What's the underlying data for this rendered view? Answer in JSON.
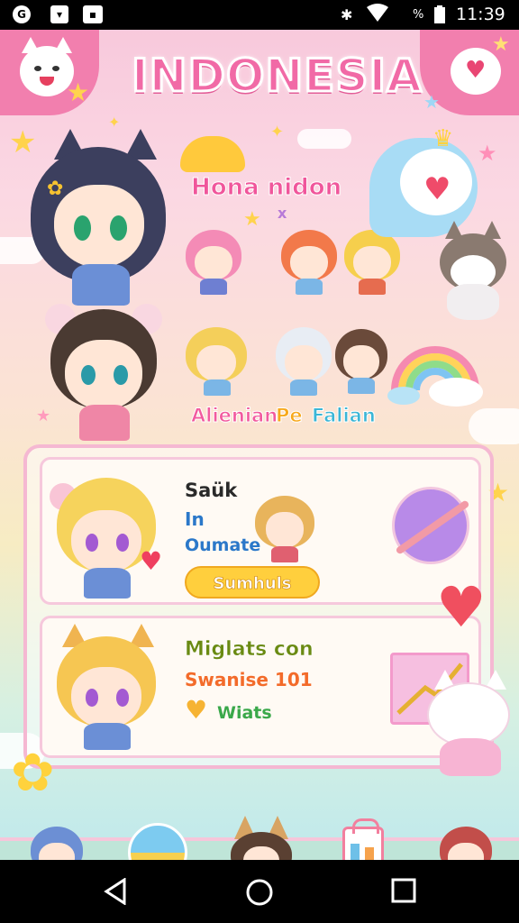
{
  "status_bar": {
    "time": "11:39",
    "battery": "%",
    "left_icons": [
      "g-logo-icon",
      "mail-icon",
      "image-icon"
    ],
    "right_icons": [
      "bluetooth-icon",
      "wifi-icon",
      "battery-icon"
    ]
  },
  "game": {
    "title": "INDONESIA",
    "banner_name": "Hona nidon",
    "banner_sub": "x",
    "subtitle_parts": [
      "Alienian",
      "Pe",
      "Falian"
    ],
    "cards": [
      {
        "line1": "Saük",
        "line2": "In",
        "line3": "Oumate",
        "button": "Sumhuls"
      },
      {
        "line1": "Miglats con",
        "line2": "Swanise 101",
        "line3": "Wiats"
      }
    ],
    "colors": {
      "title_pink": "#f16aa6",
      "title_yellow": "#ffc93c",
      "banner_pink": "#f0569b",
      "sub_pink": "#f25a9e",
      "sub_yellow": "#f7a81b",
      "sub_teal": "#3bb6d6",
      "card1_blue": "#2b78c9",
      "card2_olive": "#6a8a12",
      "card2_orange": "#f36b2a",
      "card2_green": "#3aa84a",
      "button_yellow": "#ffcf3d",
      "panel_border": "#f5b8d2"
    },
    "bottom_nav_icons": [
      "blue-cat-character-icon",
      "bird-ball-icon",
      "fox-character-icon",
      "shop-bag-icon",
      "red-hair-character-icon"
    ]
  },
  "system_nav": {
    "icons": [
      "back-icon",
      "home-icon",
      "recents-icon"
    ]
  }
}
